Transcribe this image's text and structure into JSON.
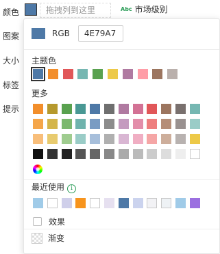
{
  "panel": {
    "labels": [
      "颜色",
      "图案",
      "大小",
      "标签",
      "提示"
    ],
    "drag_hint": "拖拽列到这里",
    "field_badge": "Abc",
    "field_name": "市场级别"
  },
  "picker": {
    "current_color": "#4E79A7",
    "rgb_label": "RGB",
    "rgb_value": "4E79A7",
    "theme_title": "主题色",
    "more_title": "更多",
    "recent_title": "最近使用",
    "effect_label": "效果",
    "gradient_label": "渐变",
    "theme_colors": [
      "#4E79A7",
      "#F28E2B",
      "#E15759",
      "#76B7B2",
      "#59A14F",
      "#EDC948",
      "#B07AA1",
      "#FF9DA7",
      "#9C755F",
      "#BAB0AC"
    ],
    "more_colors": [
      [
        "#F28E2B",
        "#B6992D",
        "#59A14F",
        "#499894",
        "#4E79A7",
        "#6F6F6F",
        "#B07AA1",
        "#D37295",
        "#E15759",
        "#9C755F",
        "#79706E",
        "#76B7B2"
      ],
      [
        "#F5A64A",
        "#D4B54A",
        "#7CB86F",
        "#6FB3AD",
        "#7A9CC3",
        "#8C8C8C",
        "#C49BBF",
        "#E38EAA",
        "#EE7E7E",
        "#B58E78",
        "#999190",
        "#9ACCC7"
      ],
      [
        "#F8BE7A",
        "#E8CB6F",
        "#9FCC8F",
        "#9ACCC7",
        "#A7BFDB",
        "#B0B0B0",
        "#D9B6D3",
        "#F0AEC3",
        "#F5A6A6",
        "#CDAE9B",
        "#B8B2B0",
        "#EDC948"
      ],
      [
        "#111111",
        "#333333",
        "#222222",
        "#555555",
        "#666666",
        "#888888",
        "#AAAAAA",
        "#BBBBBB",
        "#CCCCCC",
        "#DDDDDD",
        "#EEEEEE",
        "#FFFFFF"
      ]
    ],
    "recent_colors": [
      "#A0CBE8",
      "#FFFFFF",
      "#CFCFEA",
      "#F7941D",
      "#FFFFFF",
      "#E6E0F0",
      "#4E79A7",
      "#CBD3EE",
      "#F2F2F5",
      "#EEF2F5",
      "#A0CBE8",
      "#9B6FE0"
    ]
  }
}
